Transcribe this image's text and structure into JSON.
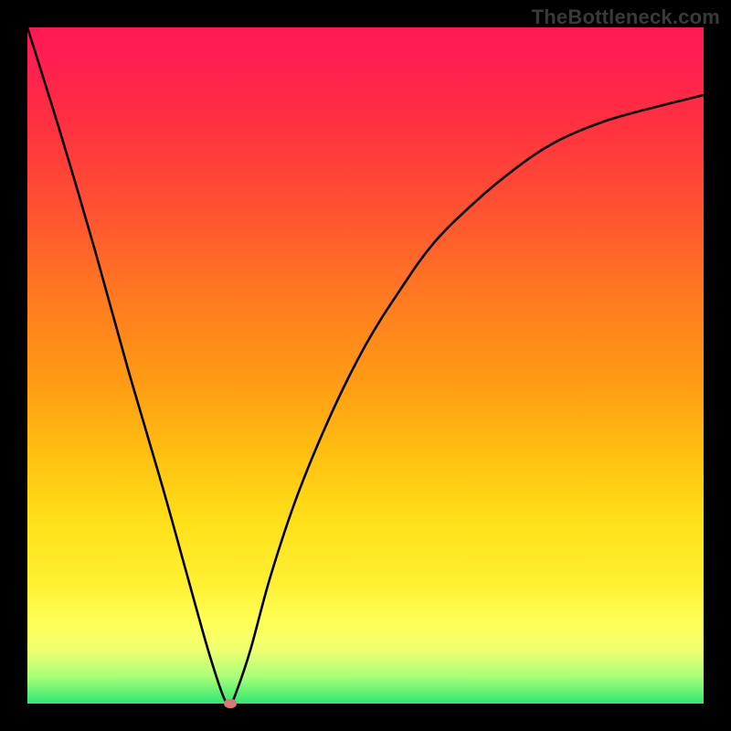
{
  "watermark": "TheBottleneck.com",
  "chart_data": {
    "type": "line",
    "title": "",
    "xlabel": "",
    "ylabel": "",
    "xlim": [
      0,
      100
    ],
    "ylim": [
      0,
      100
    ],
    "grid": false,
    "legend": false,
    "series": [
      {
        "name": "bottleneck-curve",
        "x": [
          0,
          5,
          10,
          15,
          20,
          25,
          27,
          29,
          30,
          31,
          33,
          36,
          40,
          45,
          50,
          55,
          60,
          66,
          72,
          78,
          85,
          92,
          100
        ],
        "values": [
          100,
          84,
          67,
          49,
          32,
          14,
          7,
          1,
          0,
          2,
          8,
          19,
          31,
          43,
          53,
          61,
          68,
          74,
          79,
          83,
          86,
          88,
          90
        ]
      }
    ],
    "marker": {
      "x": 30,
      "y": 0
    },
    "background_gradient": {
      "top": "#ff1854",
      "mid": "#ffbf10",
      "bottom": "#30e870"
    }
  }
}
